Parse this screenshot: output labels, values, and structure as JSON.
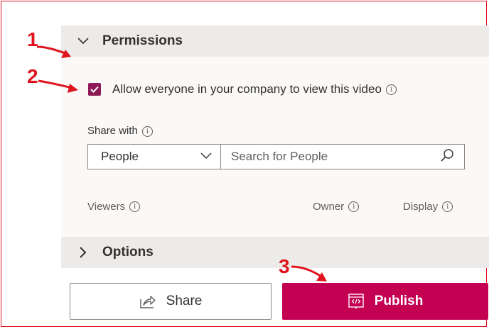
{
  "permissions": {
    "title": "Permissions",
    "allow_everyone_label": "Allow everyone in your company to view this video",
    "allow_everyone_checked": true,
    "share_with_label": "Share with",
    "share_with_select": "People",
    "search_placeholder": "Search for People",
    "columns": [
      "Viewers",
      "Owner",
      "Display"
    ]
  },
  "options": {
    "title": "Options"
  },
  "actions": {
    "share_label": "Share",
    "publish_label": "Publish"
  },
  "annotations": [
    "1",
    "2",
    "3"
  ],
  "colors": {
    "accent": "#c30052",
    "checkbox": "#8e1b57",
    "annotation": "#e0141e",
    "header_bg": "#edebe9"
  },
  "icons": [
    "chevron-down-icon",
    "checkmark-icon",
    "info-icon",
    "chevron-right-icon",
    "search-icon",
    "share-icon",
    "publish-embed-icon"
  ]
}
